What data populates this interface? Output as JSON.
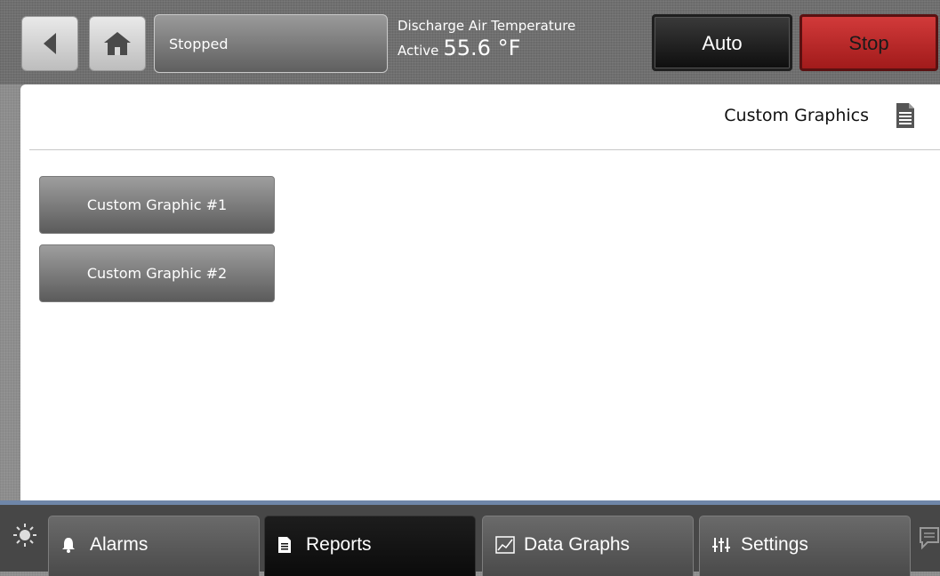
{
  "header": {
    "status": "Stopped",
    "sensor_label": "Discharge Air Temperature",
    "sensor_state": "Active",
    "sensor_value": "55.6 °F",
    "auto_label": "Auto",
    "stop_label": "Stop"
  },
  "page": {
    "title": "Custom Graphics",
    "buttons": [
      "Custom Graphic #1",
      "Custom Graphic #2"
    ]
  },
  "nav": {
    "tabs": [
      {
        "label": "Alarms",
        "icon": "bell-icon",
        "active": false
      },
      {
        "label": "Reports",
        "icon": "document-icon",
        "active": true
      },
      {
        "label": "Data Graphs",
        "icon": "chart-icon",
        "active": false
      },
      {
        "label": "Settings",
        "icon": "sliders-icon",
        "active": false
      }
    ]
  },
  "colors": {
    "stop": "#c62828",
    "nav_accent": "#6f86a8"
  }
}
